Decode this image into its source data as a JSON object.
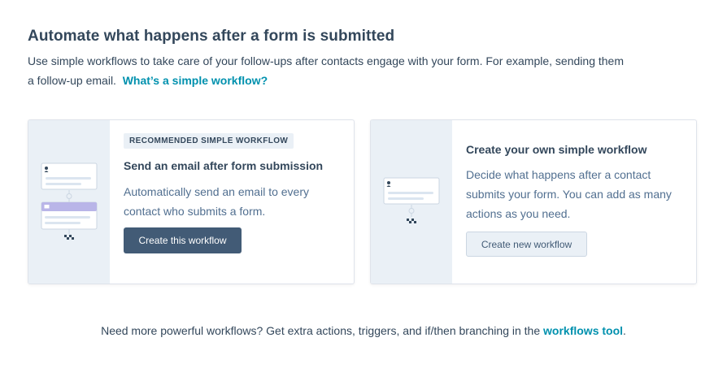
{
  "header": {
    "title": "Automate what happens after a form is submitted",
    "description": "Use simple workflows to take care of your follow-ups after contacts engage with your form. For example, sending them a follow-up email.",
    "help_link": "What’s a simple workflow?"
  },
  "recommended_card": {
    "badge": "RECOMMENDED SIMPLE WORKFLOW",
    "title": "Send an email after form submission",
    "description": "Automatically send an email to every contact who submits a form.",
    "button_label": "Create this workflow"
  },
  "custom_card": {
    "title": "Create your own simple workflow",
    "description": "Decide what happens after a contact submits your form. You can add as many actions as you need.",
    "button_label": "Create new workflow"
  },
  "footer": {
    "text": "Need more powerful workflows? Get extra actions, triggers, and if/then branching in the",
    "link": "workflows tool",
    "end": "."
  },
  "colors": {
    "text": "#33475b",
    "link": "#0091ae",
    "primary_button": "#425b76",
    "illustration_bg": "#eaf0f6",
    "accent_purple": "#b9b5e8"
  }
}
